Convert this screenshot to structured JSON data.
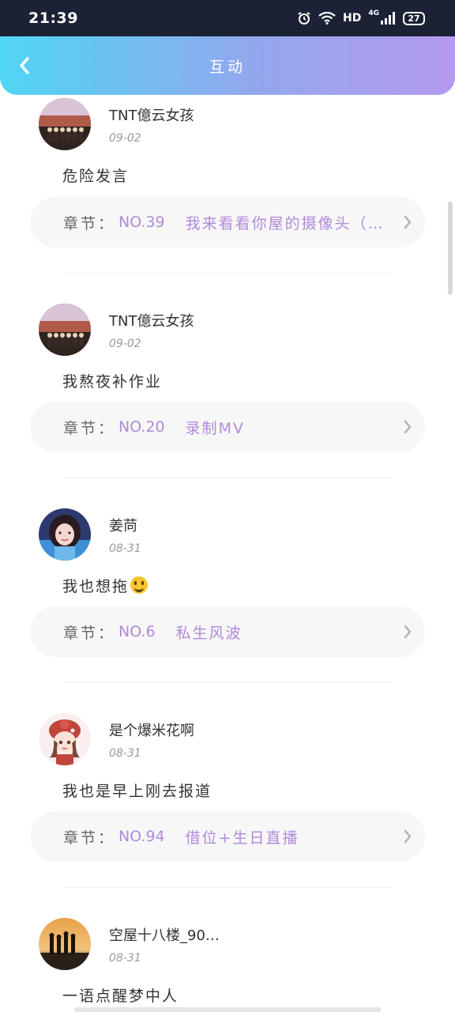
{
  "status_bar": {
    "time": "21:39",
    "network": "HD",
    "signal": "4G",
    "battery": "27"
  },
  "header": {
    "title": "互动"
  },
  "posts": [
    {
      "name": "TNT億云女孩",
      "date": "09-02",
      "content": "危险发言",
      "chapter_label": "章节：",
      "chapter_num": "NO.39",
      "chapter_title": "我来看看你屋的摄像头（…"
    },
    {
      "name": "TNT億云女孩",
      "date": "09-02",
      "content": "我熬夜补作业",
      "chapter_label": "章节：",
      "chapter_num": "NO.20",
      "chapter_title": "录制MV"
    },
    {
      "name": "姜苘",
      "date": "08-31",
      "content": "我也想拖",
      "chapter_label": "章节：",
      "chapter_num": "NO.6",
      "chapter_title": "私生风波"
    },
    {
      "name": "是个爆米花啊",
      "date": "08-31",
      "content": "我也是早上刚去报道",
      "chapter_label": "章节：",
      "chapter_num": "NO.94",
      "chapter_title": "借位+生日直播"
    },
    {
      "name": "空屋十八楼_90…",
      "date": "08-31",
      "content": "一语点醒梦中人"
    }
  ],
  "colors": {
    "accent": "#b08ad8",
    "header_start": "#4fd6f5",
    "header_end": "#b49aee"
  }
}
